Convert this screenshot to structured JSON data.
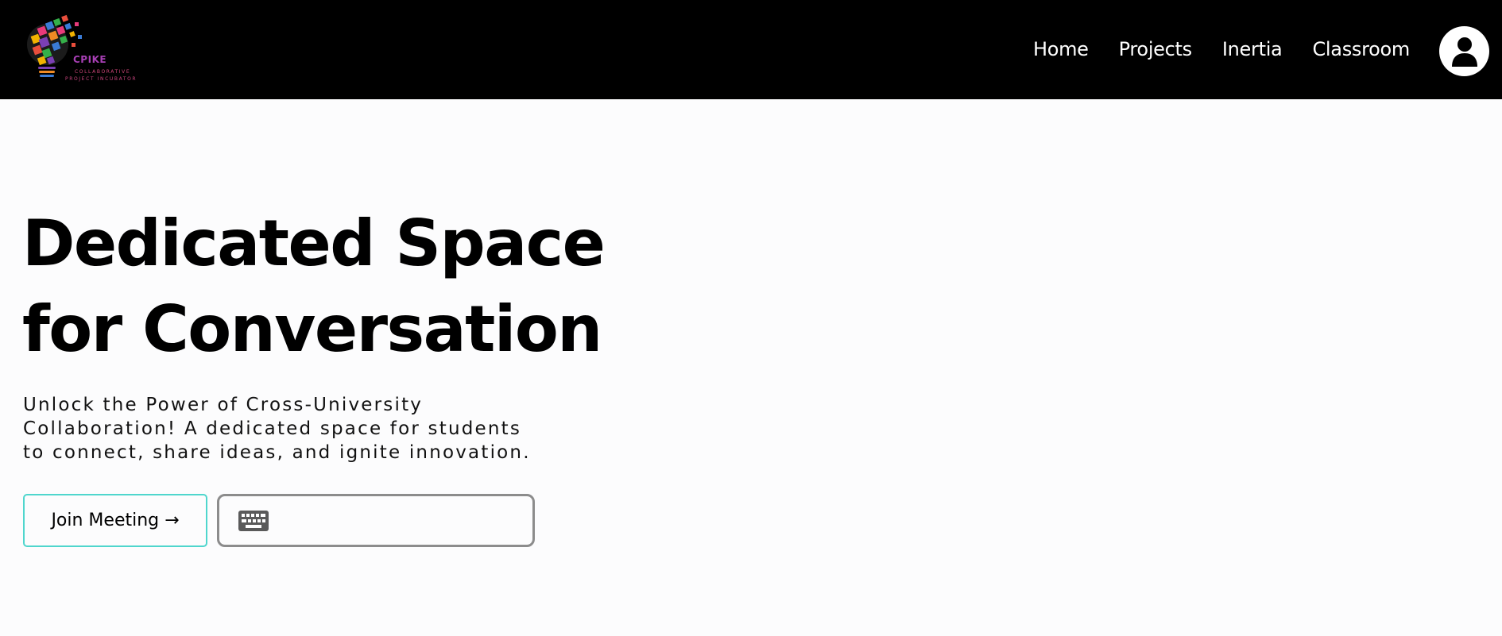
{
  "header": {
    "brand": {
      "name": "CPIKE",
      "tagline_line1": "COLLABORATIVE",
      "tagline_line2": "PROJECT INCUBATOR",
      "icon": "lightbulb-mosaic-logo"
    },
    "nav": [
      {
        "label": "Home"
      },
      {
        "label": "Projects"
      },
      {
        "label": "Inertia"
      },
      {
        "label": "Classroom"
      }
    ],
    "profile_icon": "user-icon"
  },
  "hero": {
    "title_line1": "Dedicated Space",
    "title_line2": "for Conversation",
    "subtitle_line1": "Unlock the Power of Cross-University",
    "subtitle_line2": "Collaboration! A dedicated space for students",
    "subtitle_line3": "to connect, share ideas, and ignite innovation.",
    "join_button_label": "Join Meeting →",
    "code_input": {
      "icon": "keyboard-icon",
      "value": "",
      "placeholder": ""
    }
  },
  "colors": {
    "header_bg": "#000000",
    "page_bg": "#fcfcfd",
    "join_button_border": "#4fd6cd",
    "input_border": "#8c8c8c"
  }
}
